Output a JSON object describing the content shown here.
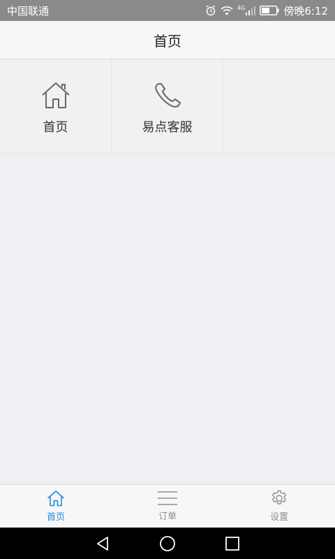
{
  "status_bar": {
    "carrier": "中国联通",
    "network": "4G",
    "time": "傍晚6:12",
    "icons": [
      "alarm-icon",
      "wifi-icon",
      "signal-icon",
      "battery-icon"
    ]
  },
  "header": {
    "title": "首页"
  },
  "grid": {
    "items": [
      {
        "label": "首页",
        "icon": "home-icon"
      },
      {
        "label": "易点客服",
        "icon": "phone-icon"
      }
    ]
  },
  "tabs": [
    {
      "label": "首页",
      "icon": "home-icon",
      "active": true
    },
    {
      "label": "订单",
      "icon": "list-icon",
      "active": false
    },
    {
      "label": "设置",
      "icon": "gear-icon",
      "active": false
    }
  ],
  "colors": {
    "status_bar": "#8a8a8a",
    "accent": "#1e8bd8",
    "background": "#efeff4"
  },
  "nav_bar": {
    "icons": [
      "back-icon",
      "home-circle-icon",
      "recent-apps-icon"
    ]
  }
}
